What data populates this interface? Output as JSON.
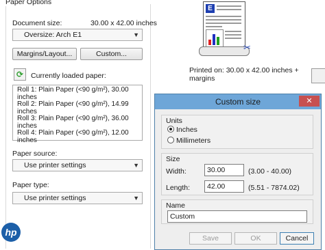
{
  "group_title": "Paper Options",
  "document_size": {
    "label": "Document size:",
    "value": "30.00 x 42.00 inches"
  },
  "size_select": {
    "value": "Oversize: Arch E1"
  },
  "margins_button": "Margins/Layout...",
  "custom_button": "Custom...",
  "loaded_paper": {
    "label": "Currently loaded paper:",
    "rolls": [
      "Roll 1: Plain Paper (<90 g/m²), 30.00 inches",
      "Roll 2: Plain Paper (<90 g/m²), 14.99 inches",
      "Roll 3: Plain Paper (<90 g/m²), 36.00 inches",
      "Roll 4: Plain Paper (<90 g/m²), 12.00 inches"
    ]
  },
  "paper_source": {
    "label": "Paper source:",
    "value": "Use printer settings"
  },
  "paper_type": {
    "label": "Paper type:",
    "value": "Use printer settings"
  },
  "preview": {
    "caption": "Printed on: 30.00 x 42.00 inches + margins",
    "letter": "E"
  },
  "brand": "hp",
  "dialog": {
    "title": "Custom size",
    "close": "✕",
    "units": {
      "title": "Units",
      "options": [
        "Inches",
        "Millimeters"
      ],
      "selected": "Inches"
    },
    "size": {
      "title": "Size",
      "width_label": "Width:",
      "width_value": "30.00",
      "width_range": "(3.00 - 40.00)",
      "length_label": "Length:",
      "length_value": "42.00",
      "length_range": "(5.51 - 7874.02)"
    },
    "name": {
      "title": "Name",
      "value": "Custom"
    },
    "buttons": {
      "save": "Save",
      "ok": "OK",
      "cancel": "Cancel"
    }
  }
}
